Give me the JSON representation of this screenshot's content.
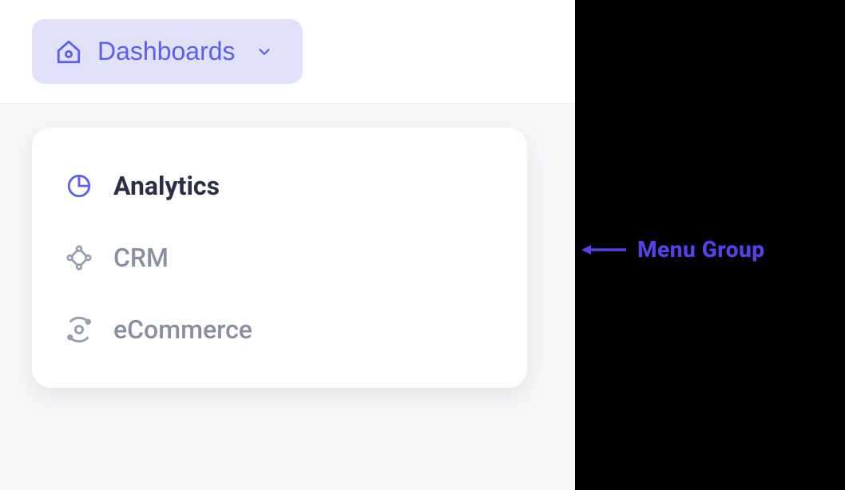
{
  "nav": {
    "label": "Dashboards"
  },
  "menu": {
    "items": [
      {
        "label": "Analytics",
        "active": true
      },
      {
        "label": "CRM",
        "active": false
      },
      {
        "label": "eCommerce",
        "active": false
      }
    ]
  },
  "annotation": {
    "label": "Menu Group"
  },
  "colors": {
    "accent": "#5b5ff0",
    "textActive": "#2a2f45",
    "textMuted": "#8a8fa0",
    "navBg": "#e2e1fa",
    "annotation": "#5243e9"
  }
}
